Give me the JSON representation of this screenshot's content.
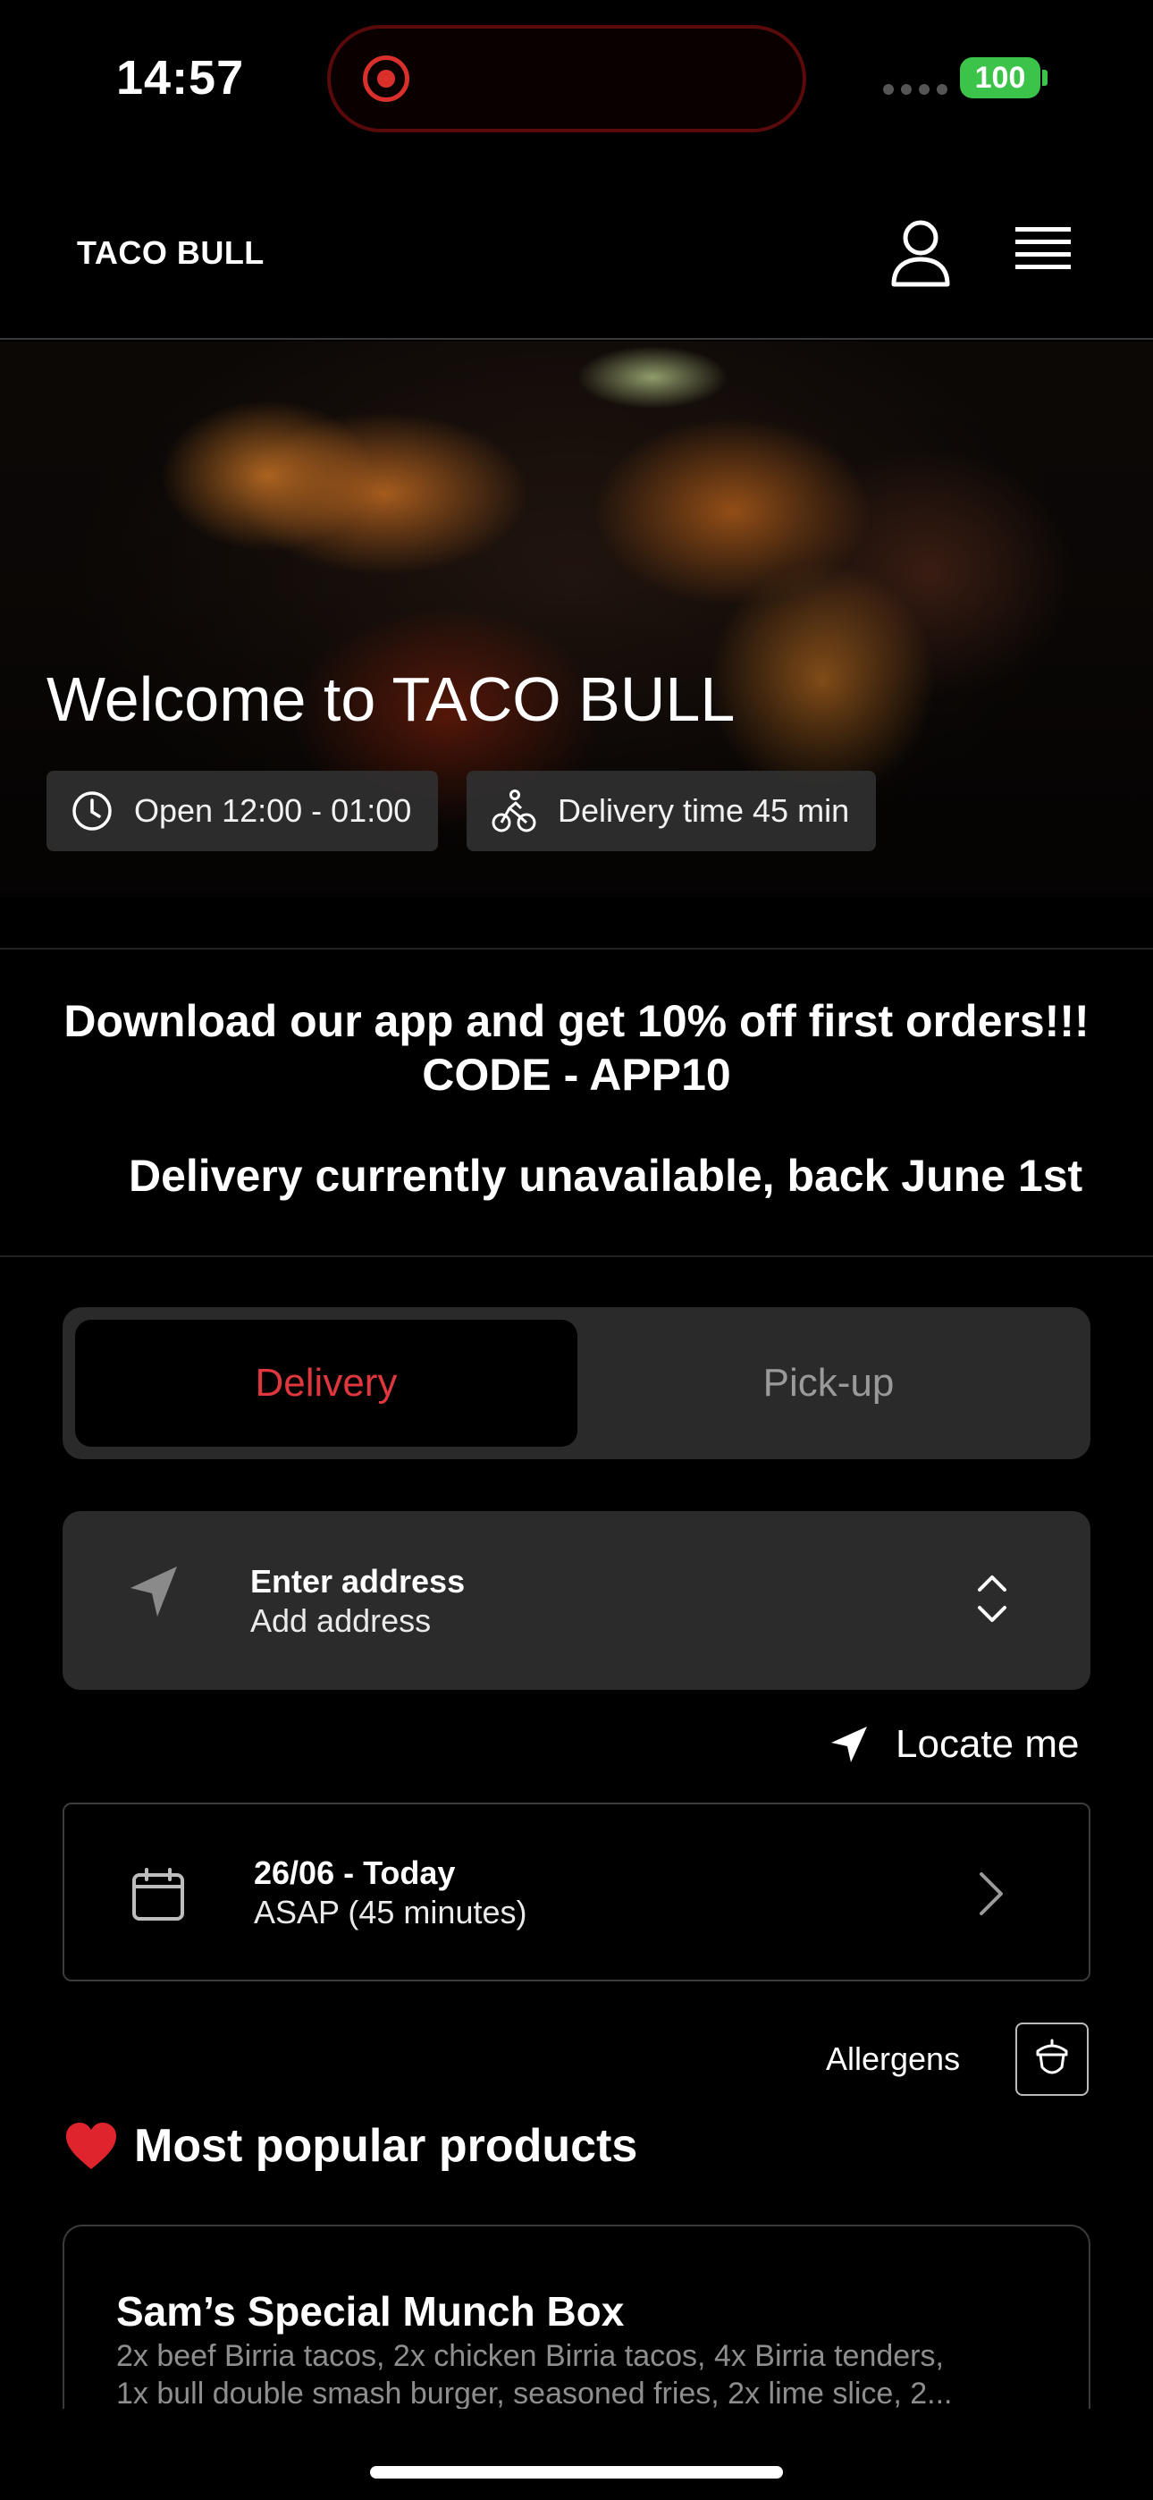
{
  "status_bar": {
    "time": "14:57",
    "battery": "100",
    "battery_color": "#3bc34a",
    "recording_color": "#d9302b"
  },
  "header": {
    "brand": "TACO BULL",
    "user_icon": "user-icon",
    "menu_icon": "hamburger-menu-icon"
  },
  "hero": {
    "title": "Welcome to TACO BULL",
    "hours": "Open 12:00 - 01:00",
    "delivery_time": "Delivery time 45 min"
  },
  "promo": {
    "line1": "Download our app and get 10% off first orders!!!",
    "line2": "CODE - APP10",
    "notice": "Delivery currently unavailable, back June 1st"
  },
  "order_mode": {
    "delivery_label": "Delivery",
    "pickup_label": "Pick-up",
    "selected": "Delivery",
    "accent_color": "#e0373e"
  },
  "address": {
    "title": "Enter address",
    "placeholder": "Add address",
    "locate_label": "Locate me"
  },
  "schedule": {
    "date": "26/06 - Today",
    "time": "ASAP (45 minutes)"
  },
  "allergens": {
    "label": "Allergens"
  },
  "popular": {
    "title": "Most popular products",
    "products": [
      {
        "name": "Sam’s Special Munch Box",
        "description_line1": "2x beef Birria tacos, 2x chicken Birria tacos, 4x Birria tenders,",
        "description_line2": "1x bull double smash burger, seasoned fries, 2x lime slice, 2..."
      }
    ]
  }
}
